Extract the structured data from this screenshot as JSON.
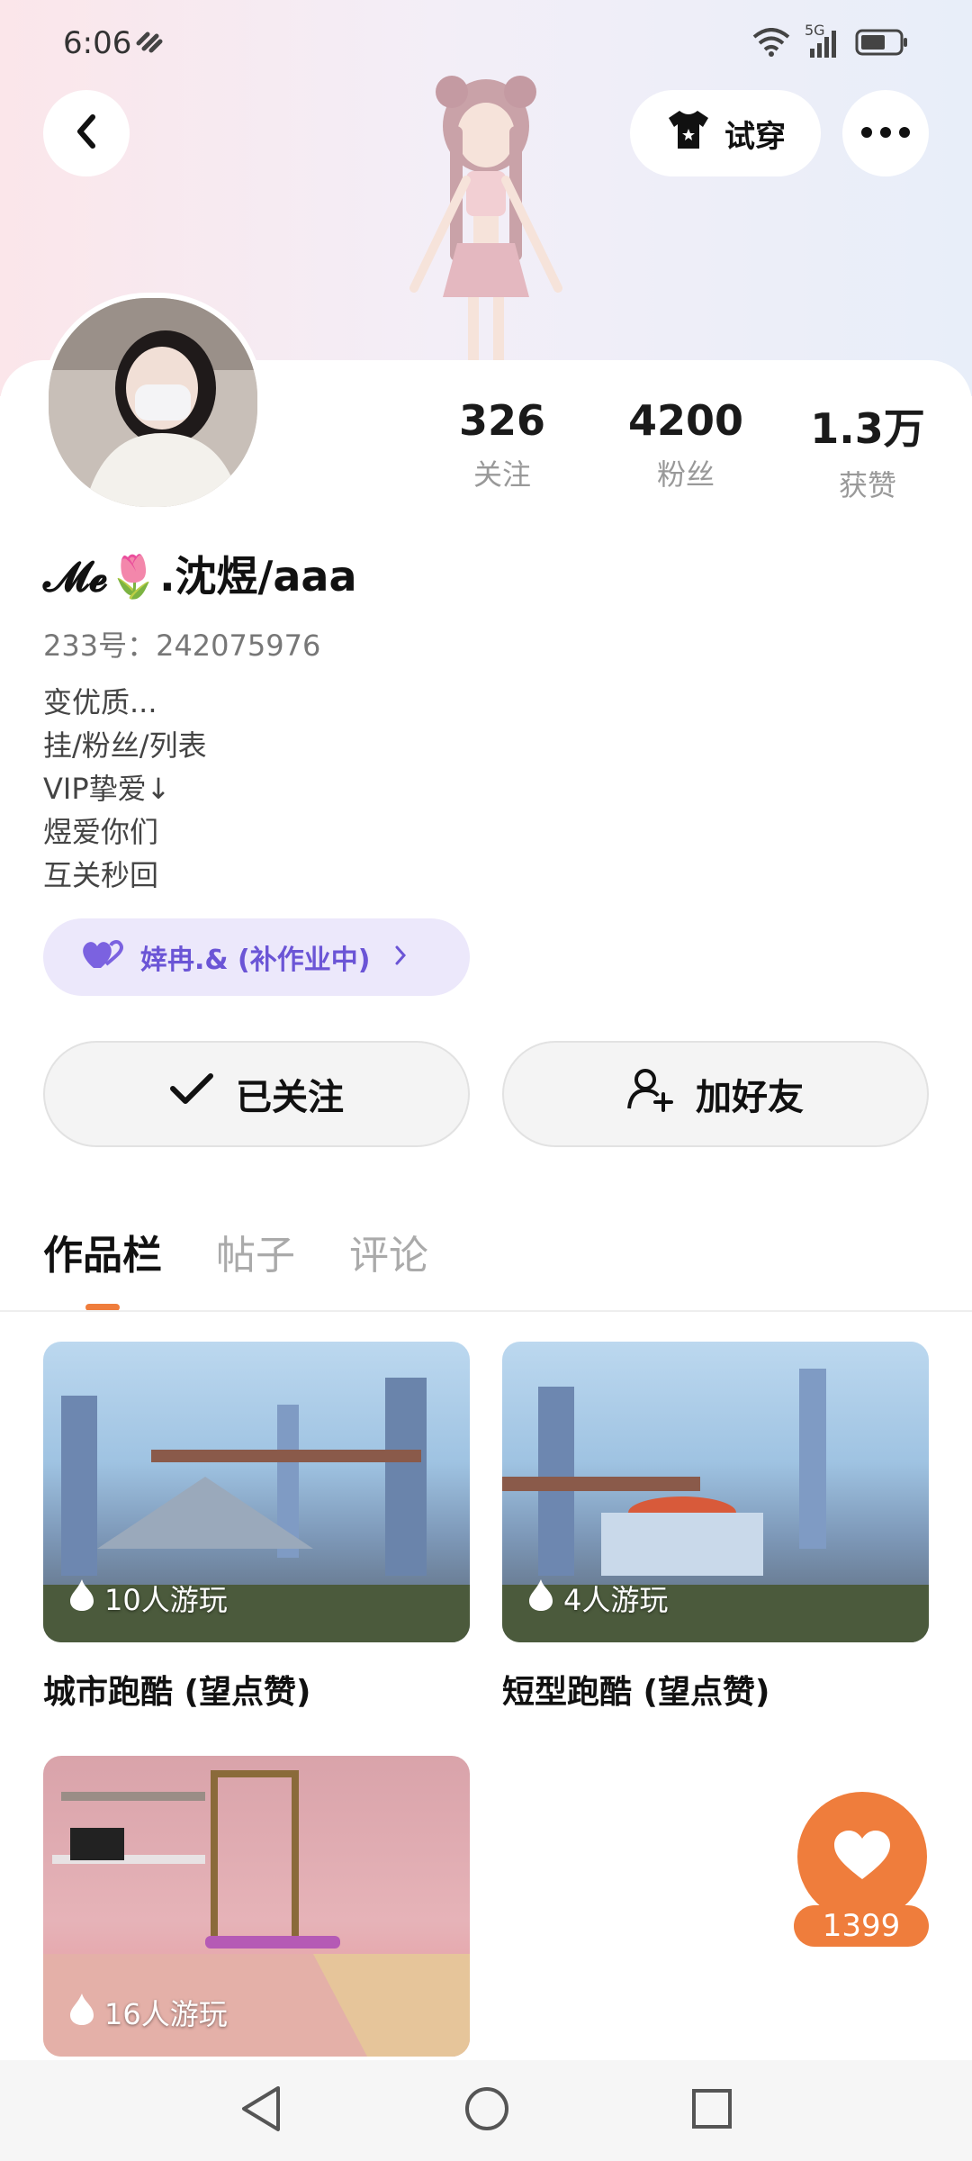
{
  "status_bar": {
    "time": "6:06",
    "network": "5G"
  },
  "header": {
    "tryon_label": "试穿"
  },
  "profile": {
    "stats": [
      {
        "value": "326",
        "label": "关注"
      },
      {
        "value": "4200",
        "label": "粉丝"
      },
      {
        "value": "1.3万",
        "label": "获赞"
      }
    ],
    "username": "𝓜𝓮🌷.沈煜/aaa",
    "uid": "233号：242075976",
    "bio": [
      "变优质...",
      "挂/粉丝/列表",
      "VIP挚爱↓",
      "煜爱你们",
      "互关秒回"
    ],
    "cp_label": "婞冉.& (补作业中)"
  },
  "actions": {
    "follow_label": "已关注",
    "add_friend_label": "加好友"
  },
  "tabs": [
    {
      "label": "作品栏",
      "active": true
    },
    {
      "label": "帖子",
      "active": false
    },
    {
      "label": "评论",
      "active": false
    }
  ],
  "works": [
    {
      "title": "城市跑酷 (望点赞)",
      "plays": "10人游玩"
    },
    {
      "title": "短型跑酷 (望点赞)",
      "plays": "4人游玩"
    },
    {
      "title": "",
      "plays": "16人游玩"
    }
  ],
  "like_button": {
    "count": "1399"
  },
  "colors": {
    "accent": "#ef7d3c",
    "cp_purple": "#6b55d6",
    "cp_bg": "#ece8fb"
  }
}
